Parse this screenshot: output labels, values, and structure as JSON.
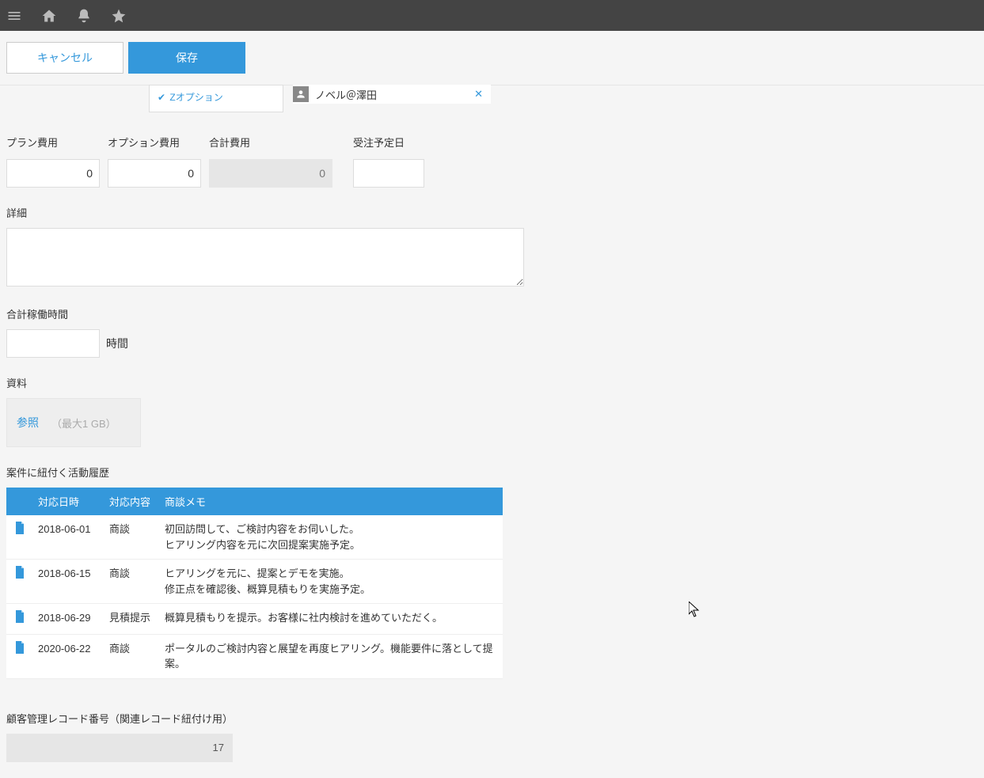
{
  "header": {},
  "actions": {
    "cancel": "キャンセル",
    "save": "保存"
  },
  "options": {
    "z_option": "Zオプション"
  },
  "person": {
    "name": "ノベル＠澤田"
  },
  "fields": {
    "plan_cost_label": "プラン費用",
    "plan_cost_value": "0",
    "option_cost_label": "オプション費用",
    "option_cost_value": "0",
    "total_cost_label": "合計費用",
    "total_cost_value": "0",
    "order_date_label": "受注予定日",
    "order_date_value": "",
    "detail_label": "詳細",
    "detail_value": "",
    "hours_label": "合計稼働時間",
    "hours_value": "",
    "hours_unit": "時間",
    "attachments_label": "資料",
    "browse_label": "参照",
    "max_hint": "（最大1 GB）"
  },
  "activity": {
    "title": "案件に紐付く活動履歴",
    "cols": {
      "date": "対応日時",
      "type": "対応内容",
      "memo": "商談メモ"
    },
    "rows": [
      {
        "date": "2018-06-01",
        "type": "商談",
        "memo": "初回訪問して、ご検討内容をお伺いした。\nヒアリング内容を元に次回提案実施予定。"
      },
      {
        "date": "2018-06-15",
        "type": "商談",
        "memo": "ヒアリングを元に、提案とデモを実施。\n修正点を確認後、概算見積もりを実施予定。"
      },
      {
        "date": "2018-06-29",
        "type": "見積提示",
        "memo": "概算見積もりを提示。お客様に社内検討を進めていただく。"
      },
      {
        "date": "2020-06-22",
        "type": "商談",
        "memo": "ポータルのご検討内容と展望を再度ヒアリング。機能要件に落として提案。"
      }
    ]
  },
  "customer": {
    "label": "顧客管理レコード番号（関連レコード紐付け用）",
    "value": "17"
  }
}
